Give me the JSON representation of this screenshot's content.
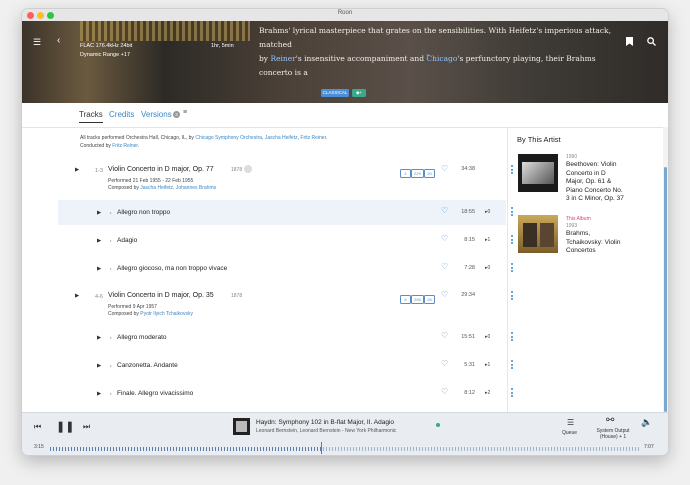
{
  "app": {
    "window_title": "Roon"
  },
  "hero": {
    "format": "FLAC 176.4kHz 24bit",
    "dynamic_range": "Dynamic Range",
    "dynamic_range_value": "+17",
    "duration": "1hr, 5min",
    "review_line1": "Brahms' lyrical masterpiece that grates on the sensibilities. With Heifetz's imperious attack, matched",
    "review_line2_pre": "by ",
    "review_link1": "Reiner",
    "review_line2_mid": "'s insensitive accompaniment and ",
    "review_link2": "Chicago",
    "review_line2_post": "'s perfunctory playing, their Brahms concerto is a",
    "genre_tag": "CLASSICAL",
    "tag_plus": "+",
    "expand_icon": "chevron-down-icon"
  },
  "tabs": {
    "tracks": "Tracks",
    "credits": "Credits",
    "versions": "Versions",
    "versions_count": "3"
  },
  "credits_note": {
    "prefix": "All tracks performed Orchestra Hall, Chicago, IL, by ",
    "orchestra": "Chicago Symphony Orchestra",
    "sep1": ", ",
    "heifetz": "Jascha Heifetz",
    "sep2": ", ",
    "reiner": "Fritz Reiner",
    "suffix": ".",
    "conducted_by": "Conducted by ",
    "conductor": "Fritz Reiner",
    "end": "."
  },
  "works": [
    {
      "range": "1-3",
      "title": "Violin Concerto in D major, Op. 77",
      "year": "1878",
      "performed": "Performed 21 Feb 1955 - 22 Feb 1955",
      "composed_by": "Composed by ",
      "composer": "Jascha Heifetz, Johannes Brahms",
      "badges": [
        "4",
        "229",
        "20"
      ],
      "duration": "34:38",
      "tracks": [
        {
          "title": "Allegro non troppo",
          "duration": "18:55",
          "plays": "0"
        },
        {
          "title": "Adagio",
          "duration": "8:15",
          "plays": "1"
        },
        {
          "title": "Allegro giocoso, ma non troppo vivace",
          "duration": "7:28",
          "plays": "0"
        }
      ]
    },
    {
      "range": "4-6",
      "title": "Violin Concerto in D major, Op. 35",
      "year": "1878",
      "performed": "Performed 9 Apr 1957",
      "composed_by": "Composed by ",
      "composer": "Pyotr Ilyich Tchaikovsky",
      "badges": [
        "6",
        "255",
        "26"
      ],
      "duration": "29:34",
      "tracks": [
        {
          "title": "Allegro moderato",
          "duration": "15:51",
          "plays": "0"
        },
        {
          "title": "Canzonetta. Andante",
          "duration": "5:31",
          "plays": "1"
        },
        {
          "title": "Finale. Allegro vivacissimo",
          "duration": "8:12",
          "plays": "2"
        }
      ]
    }
  ],
  "sidebar": {
    "heading": "By This Artist",
    "albums": [
      {
        "year": "1990",
        "title_lines": [
          "Beethoven: Violin",
          "Concerto in D",
          "Major, Op. 61 &",
          "Piano Concerto No.",
          "3 in C Minor, Op. 37"
        ],
        "label": ""
      },
      {
        "year": "1993",
        "title_lines": [
          "Brahms,",
          "Tchaikovsky: Violin",
          "Concertos"
        ],
        "label": "This Album"
      }
    ]
  },
  "player": {
    "track": "Haydn: Symphony 102 in B-flat Major, II. Adagio",
    "artists": "Leonard Bernstein, Leonard Bernstein - New York Philharmonic",
    "elapsed": "3:15",
    "total": "7:07",
    "progress": 0.46,
    "queue": "Queue",
    "output": "System Output",
    "output_sub": "(House) + 1"
  },
  "colors": {
    "accent": "#3a87c5",
    "genre_tag": "#4a90d9",
    "plus_tag": "#3aa88a",
    "this_album": "#d9457a"
  }
}
